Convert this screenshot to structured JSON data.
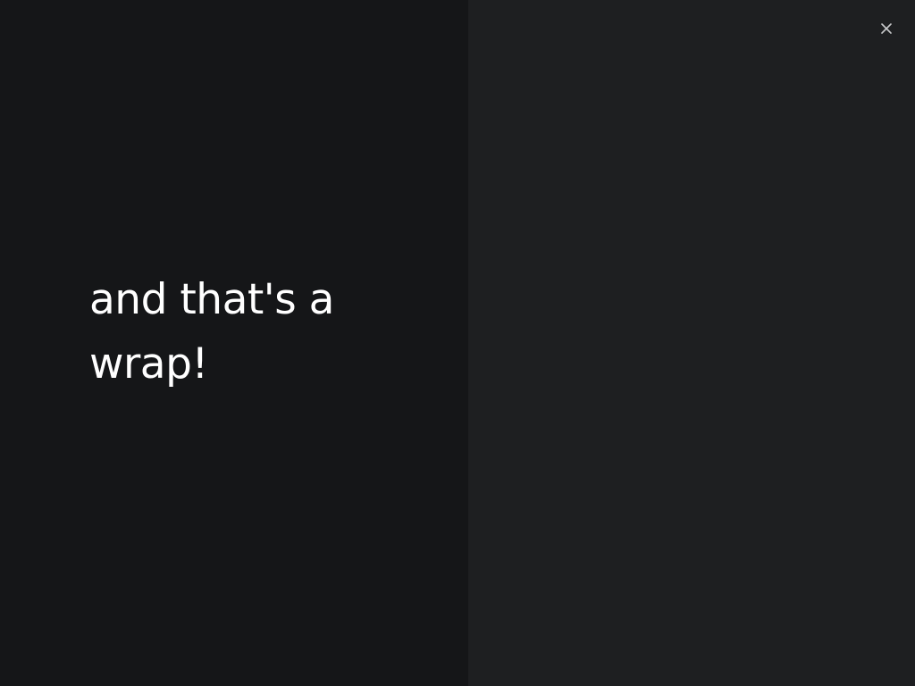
{
  "slide": {
    "headline": "and that's a wrap!"
  },
  "colors": {
    "left_panel": "#151618",
    "right_panel": "#1e1f21",
    "text": "#ffffff",
    "close_icon": "#c9cacc"
  },
  "icons": {
    "close": "close-icon"
  }
}
